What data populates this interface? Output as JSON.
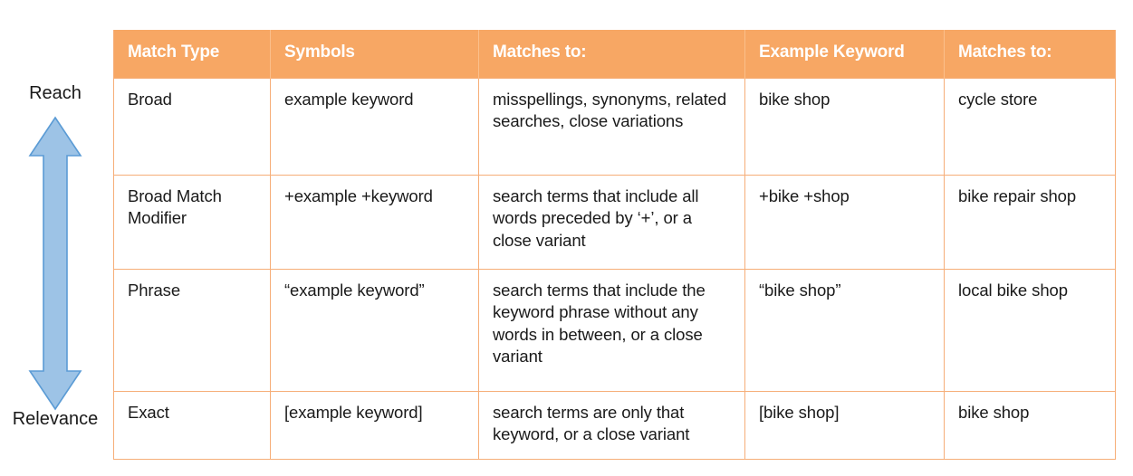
{
  "axis": {
    "top_label": "Reach",
    "bottom_label": "Relevance",
    "arrow_icon": "double-headed-vertical-arrow-icon",
    "arrow_fill": "#9DC3E6",
    "arrow_stroke": "#5B9BD5"
  },
  "table": {
    "header_bg": "#F7A764",
    "header_text_color": "#FFFFFF",
    "border_color": "#F6AE78",
    "columns": [
      "Match Type",
      "Symbols",
      "Matches to:",
      "Example Keyword",
      "Matches to:"
    ],
    "rows": [
      {
        "match_type": "Broad",
        "symbols": "example keyword",
        "matches_to": "misspellings, synonyms, related searches, close variations",
        "example_keyword": "bike shop",
        "example_matches_to": "cycle store"
      },
      {
        "match_type": "Broad Match Modifier",
        "symbols": "+example +keyword",
        "matches_to": "search terms that include all words preceded by ‘+’, or a close variant",
        "example_keyword": "+bike +shop",
        "example_matches_to": "bike repair shop"
      },
      {
        "match_type": "Phrase",
        "symbols": "“example keyword”",
        "matches_to": "search terms that include the keyword phrase without any words in between, or a close variant",
        "example_keyword": "“bike shop”",
        "example_matches_to": "local bike shop"
      },
      {
        "match_type": "Exact",
        "symbols": "[example keyword]",
        "matches_to": "search terms are only that keyword, or a close variant",
        "example_keyword": "[bike shop]",
        "example_matches_to": "bike shop"
      }
    ]
  }
}
